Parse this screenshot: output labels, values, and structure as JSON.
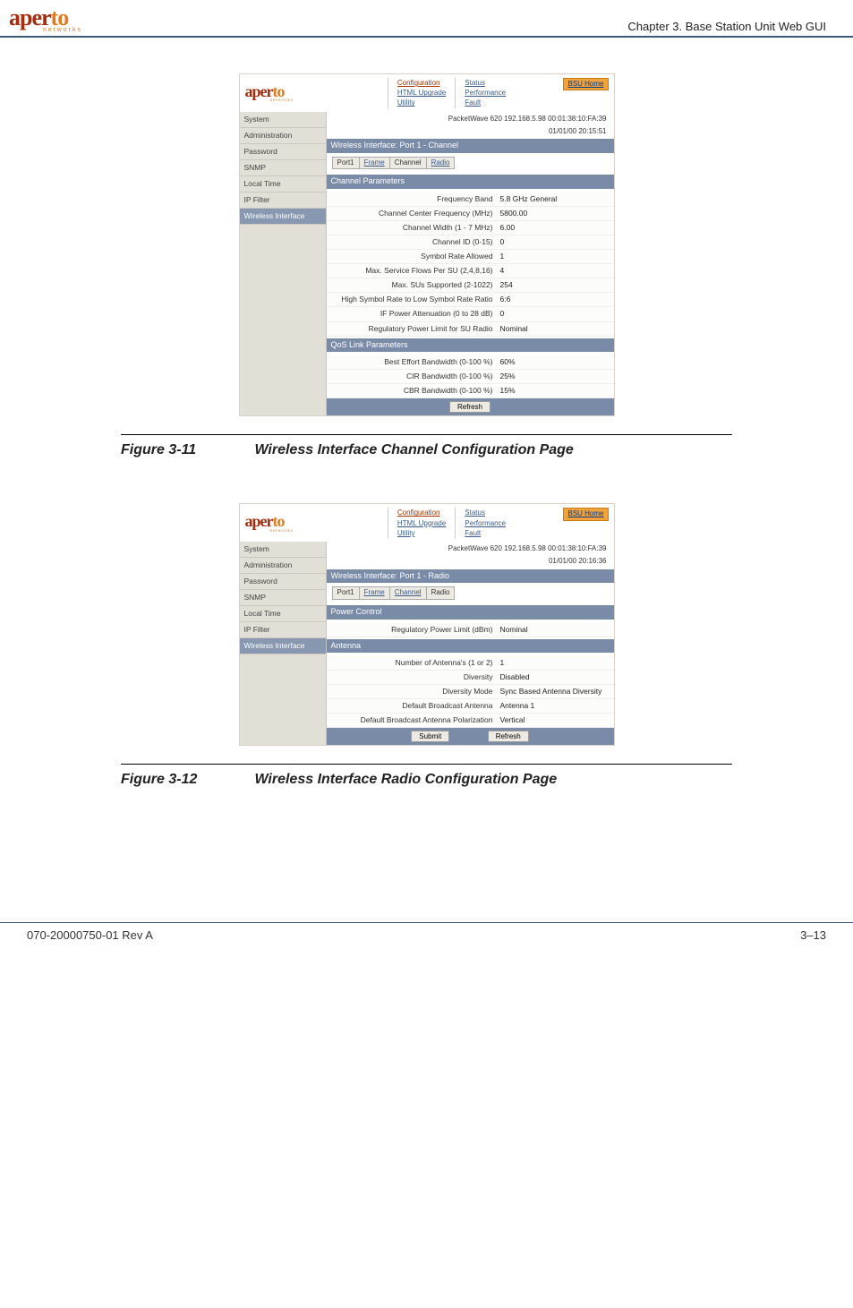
{
  "header": {
    "logo_main_a": "aper",
    "logo_main_b": "to",
    "logo_sub": "networks",
    "chapter": "Chapter 3.  Base Station Unit Web GUI"
  },
  "nav": {
    "col1": [
      "Configuration",
      "HTML Upgrade",
      "Utility"
    ],
    "col2": [
      "Status",
      "Performance",
      "Fault"
    ],
    "bsu": "BSU Home"
  },
  "sidebar": [
    "System",
    "Administration",
    "Password",
    "SNMP",
    "Local Time",
    "IP Filter",
    "Wireless Interface"
  ],
  "tabs": [
    "Port1",
    "Frame",
    "Channel",
    "Radio"
  ],
  "fig1": {
    "status1": "PacketWave 620    192.168.5.98    00:01:38:10:FA:39",
    "status2": "01/01/00    20:15:51",
    "title": "Wireless Interface: Port 1 - Channel",
    "section_ch": "Channel Parameters",
    "section_qos": "QoS Link Parameters",
    "rows_ch": [
      {
        "label": "Frequency Band",
        "val": "5.8 GHz General"
      },
      {
        "label": "Channel Center Frequency (MHz)",
        "val": "5800.00"
      },
      {
        "label": "Channel Width (1 - 7 MHz)",
        "val": "6.00"
      },
      {
        "label": "Channel ID (0-15)",
        "val": "0"
      },
      {
        "label": "Symbol Rate Allowed",
        "val": "1"
      },
      {
        "label": "Max. Service Flows Per SU (2,4,8,16)",
        "val": "4"
      },
      {
        "label": "Max. SUs Supported (2-1022)",
        "val": "254"
      },
      {
        "label": "High Symbol Rate to Low Symbol Rate Ratio",
        "val": "6:6"
      },
      {
        "label": "IF Power Attenuation (0 to 28 dB)",
        "val": "0"
      },
      {
        "label": "Regulatory Power Limit for SU Radio",
        "val": "Nominal"
      }
    ],
    "rows_qos": [
      {
        "label": "Best Effort Bandwidth (0-100 %)",
        "val": "60%"
      },
      {
        "label": "CIR Bandwidth (0-100 %)",
        "val": "25%"
      },
      {
        "label": "CBR Bandwidth (0-100 %)",
        "val": "15%"
      }
    ],
    "btn": "Refresh",
    "caption_num": "Figure 3-11",
    "caption_text": "Wireless Interface Channel Configuration Page"
  },
  "fig2": {
    "status1": "PacketWave 620    192.168.5.98    00:01:38:10:FA:39",
    "status2": "01/01/00    20:16:36",
    "title": "Wireless Interface: Port 1 - Radio",
    "section_pw": "Power Control",
    "section_an": "Antenna",
    "rows_pw": [
      {
        "label": "Regulatory Power Limit (dBm)",
        "val": "Nominal"
      }
    ],
    "rows_an": [
      {
        "label": "Number of Antenna's (1 or 2)",
        "val": "1"
      },
      {
        "label": "Diversity",
        "val": "Disabled"
      },
      {
        "label": "Diversity Mode",
        "val": "Sync Based Antenna Diversity"
      },
      {
        "label": "Default Broadcast Antenna",
        "val": "Antenna 1"
      },
      {
        "label": "Default Broadcast Antenna Polarization",
        "val": "Vertical"
      }
    ],
    "btn1": "Submit",
    "btn2": "Refresh",
    "caption_num": "Figure 3-12",
    "caption_text": "Wireless Interface Radio Configuration Page"
  },
  "footer": {
    "left": "070-20000750-01 Rev A",
    "right": "3–13"
  }
}
